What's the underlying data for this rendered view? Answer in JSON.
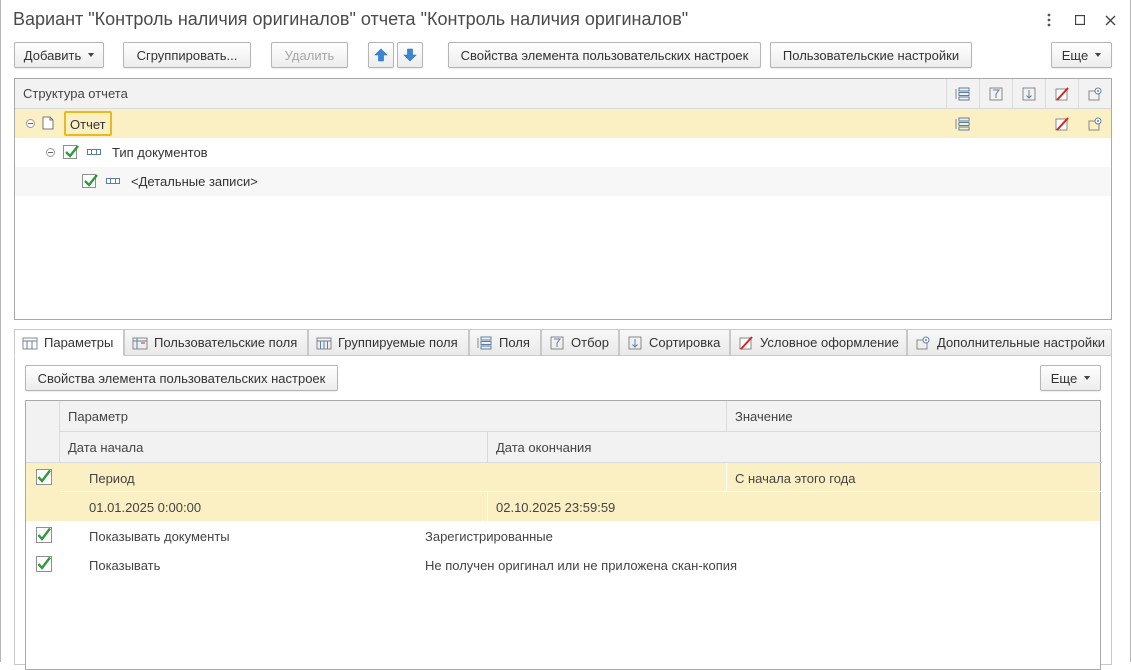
{
  "window": {
    "title": "Вариант \"Контроль наличия оригиналов\" отчета \"Контроль наличия оригиналов\""
  },
  "toolbar": {
    "add_label": "Добавить",
    "group_label": "Сгруппировать...",
    "delete_label": "Удалить",
    "element_props_label": "Свойства элемента пользовательских настроек",
    "user_settings_label": "Пользовательские настройки",
    "more_label": "Еще"
  },
  "structure": {
    "header": "Структура отчета",
    "rows": [
      {
        "label": "Отчет"
      },
      {
        "label": "Тип документов"
      },
      {
        "label": "<Детальные записи>"
      }
    ]
  },
  "tabs": [
    {
      "label": "Параметры"
    },
    {
      "label": "Пользовательские поля"
    },
    {
      "label": "Группируемые поля"
    },
    {
      "label": "Поля"
    },
    {
      "label": "Отбор"
    },
    {
      "label": "Сортировка"
    },
    {
      "label": "Условное оформление"
    },
    {
      "label": "Дополнительные настройки"
    }
  ],
  "params_panel": {
    "element_props_label": "Свойства элемента пользовательских настроек",
    "more_label": "Еще",
    "columns": {
      "parameter": "Параметр",
      "value": "Значение",
      "start_date": "Дата начала",
      "end_date": "Дата окончания"
    },
    "rows": [
      {
        "checked": true,
        "name": "Период",
        "value": "С начала этого года",
        "start": "01.01.2025 0:00:00",
        "end": "02.10.2025 23:59:59"
      },
      {
        "checked": true,
        "name": "Показывать документы",
        "value": "Зарегистрированные"
      },
      {
        "checked": true,
        "name": "Показывать",
        "value": "Не получен оригинал или не приложена скан-копия"
      }
    ]
  },
  "colors": {
    "selected_row": "#fbf0c4",
    "check_green": "#2e9a3a",
    "arrow_blue": "#3a86d6",
    "focus_border": "#e8b923"
  }
}
